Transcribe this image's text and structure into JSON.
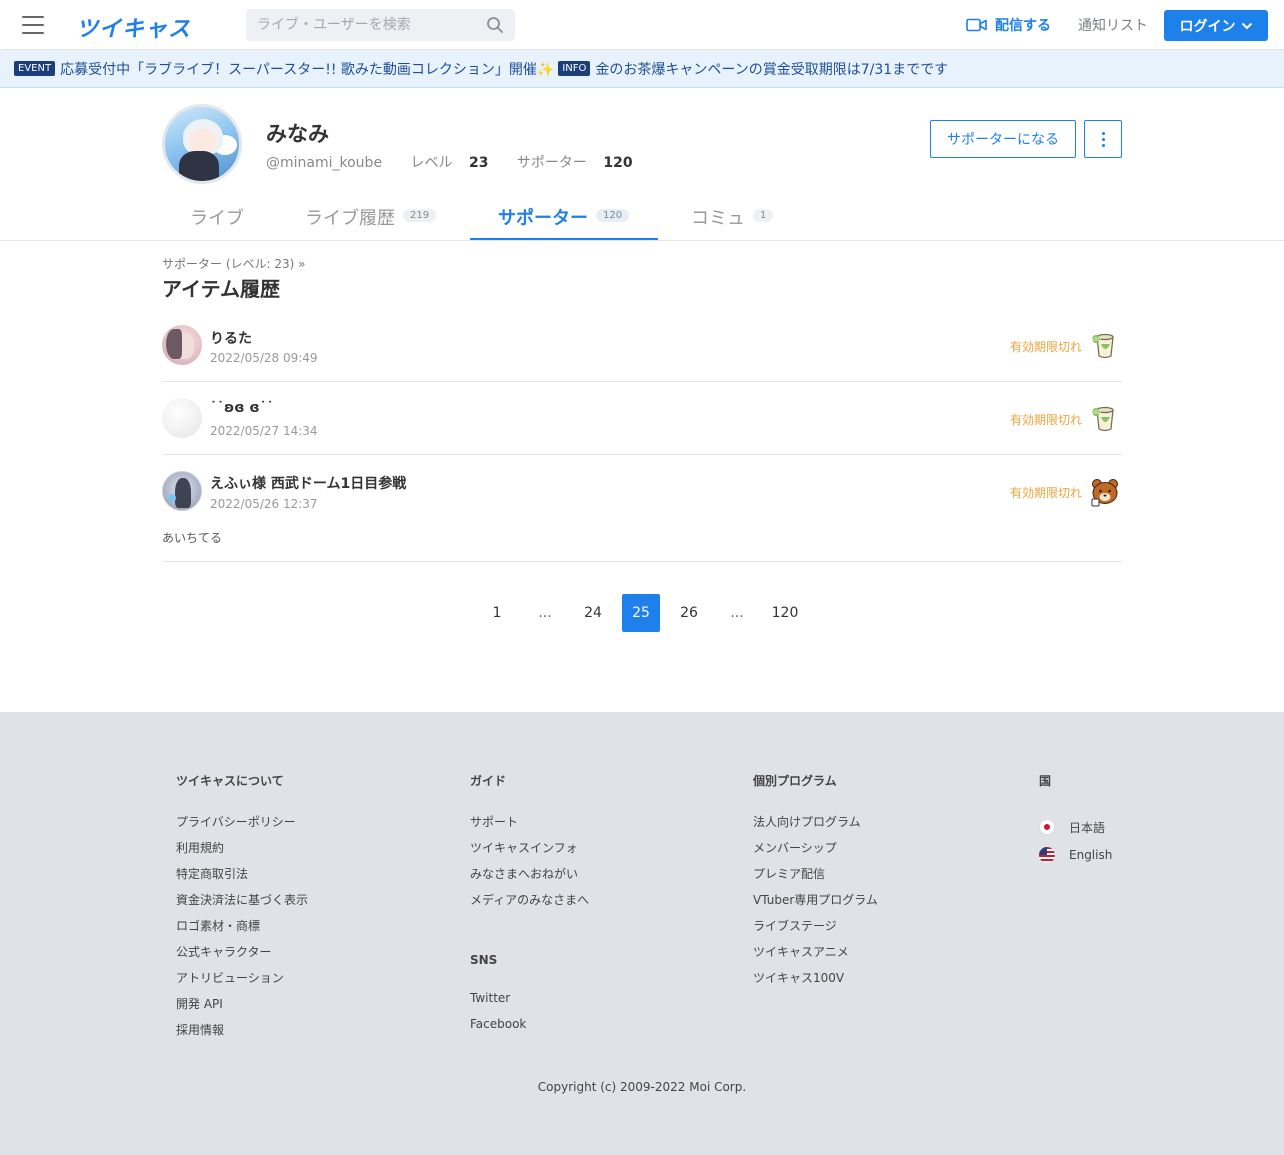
{
  "header": {
    "logo": "ツイキャス",
    "search_placeholder": "ライブ・ユーザーを検索",
    "broadcast_label": "配信する",
    "notify_label": "通知リスト",
    "login_label": "ログイン"
  },
  "notices": [
    {
      "tag": "EVENT",
      "text": "応募受付中「ラブライブ！スーパースター!! 歌みた動画コレクション」開催✨"
    },
    {
      "tag": "INFO",
      "text": "金のお茶爆キャンペーンの賞金受取期限は7/31までです"
    }
  ],
  "profile": {
    "name": "みなみ",
    "handle": "@minami_koube",
    "level_label": "レベル",
    "level": "23",
    "supporter_label": "サポーター",
    "supporter_count": "120",
    "become_supporter_label": "サポーターになる"
  },
  "tabs": [
    {
      "label": "ライブ",
      "count": ""
    },
    {
      "label": "ライブ履歴",
      "count": "219"
    },
    {
      "label": "サポーター",
      "count": "120"
    },
    {
      "label": "コミュ",
      "count": "1"
    }
  ],
  "breadcrumb": "サポーター (レベル: 23)  »",
  "section_title": "アイテム履歴",
  "items": [
    {
      "user": "りるた⁡⁡",
      "time": "2022/05/28 09:49",
      "status": "有効期限切れ",
      "gift": "tea-icon",
      "message": ""
    },
    {
      "user": "˙˙ʚɞ ɞ˙˙",
      "time": "2022/05/27 14:34",
      "status": "有効期限切れ",
      "gift": "tea-icon",
      "message": ""
    },
    {
      "user": "えふぃ様 ⁡西武ドーム1日目参戦⁡",
      "time": "2022/05/26 12:37",
      "status": "有効期限切れ",
      "gift": "bear-icon",
      "message": "あいちてる"
    }
  ],
  "pagination": [
    "1",
    "...",
    "24",
    "25",
    "26",
    "...",
    "120"
  ],
  "pagination_current": "25",
  "footer": {
    "col1": {
      "title": "ツイキャスについて",
      "links": [
        "プライバシーポリシー",
        "利用規約",
        "特定商取引法",
        "資金決済法に基づく表示",
        "ロゴ素材・商標",
        "公式キャラクター",
        "アトリビューション",
        "開発 API",
        "採用情報"
      ]
    },
    "col2": {
      "title": "ガイド",
      "links": [
        "サポート",
        "ツイキャスインフォ",
        "みなさまへおねがい",
        "メディアのみなさまへ"
      ]
    },
    "col2b": {
      "title": "SNS",
      "links": [
        "Twitter",
        "Facebook"
      ]
    },
    "col3": {
      "title": "個別プログラム",
      "links": [
        "法人向けプログラム",
        "メンバーシップ",
        "プレミア配信",
        "VTuber専用プログラム",
        "ライブステージ",
        "ツイキャスアニメ",
        "ツイキャス100V"
      ]
    },
    "col4": {
      "title": "国",
      "langs": [
        "日本語",
        "English"
      ]
    },
    "copyright": "Copyright (c) 2009-2022 Moi Corp."
  },
  "colors": {
    "accent": "#1e80ea",
    "expired": "#f0a33a",
    "footer_bg": "#dfe2e6"
  }
}
